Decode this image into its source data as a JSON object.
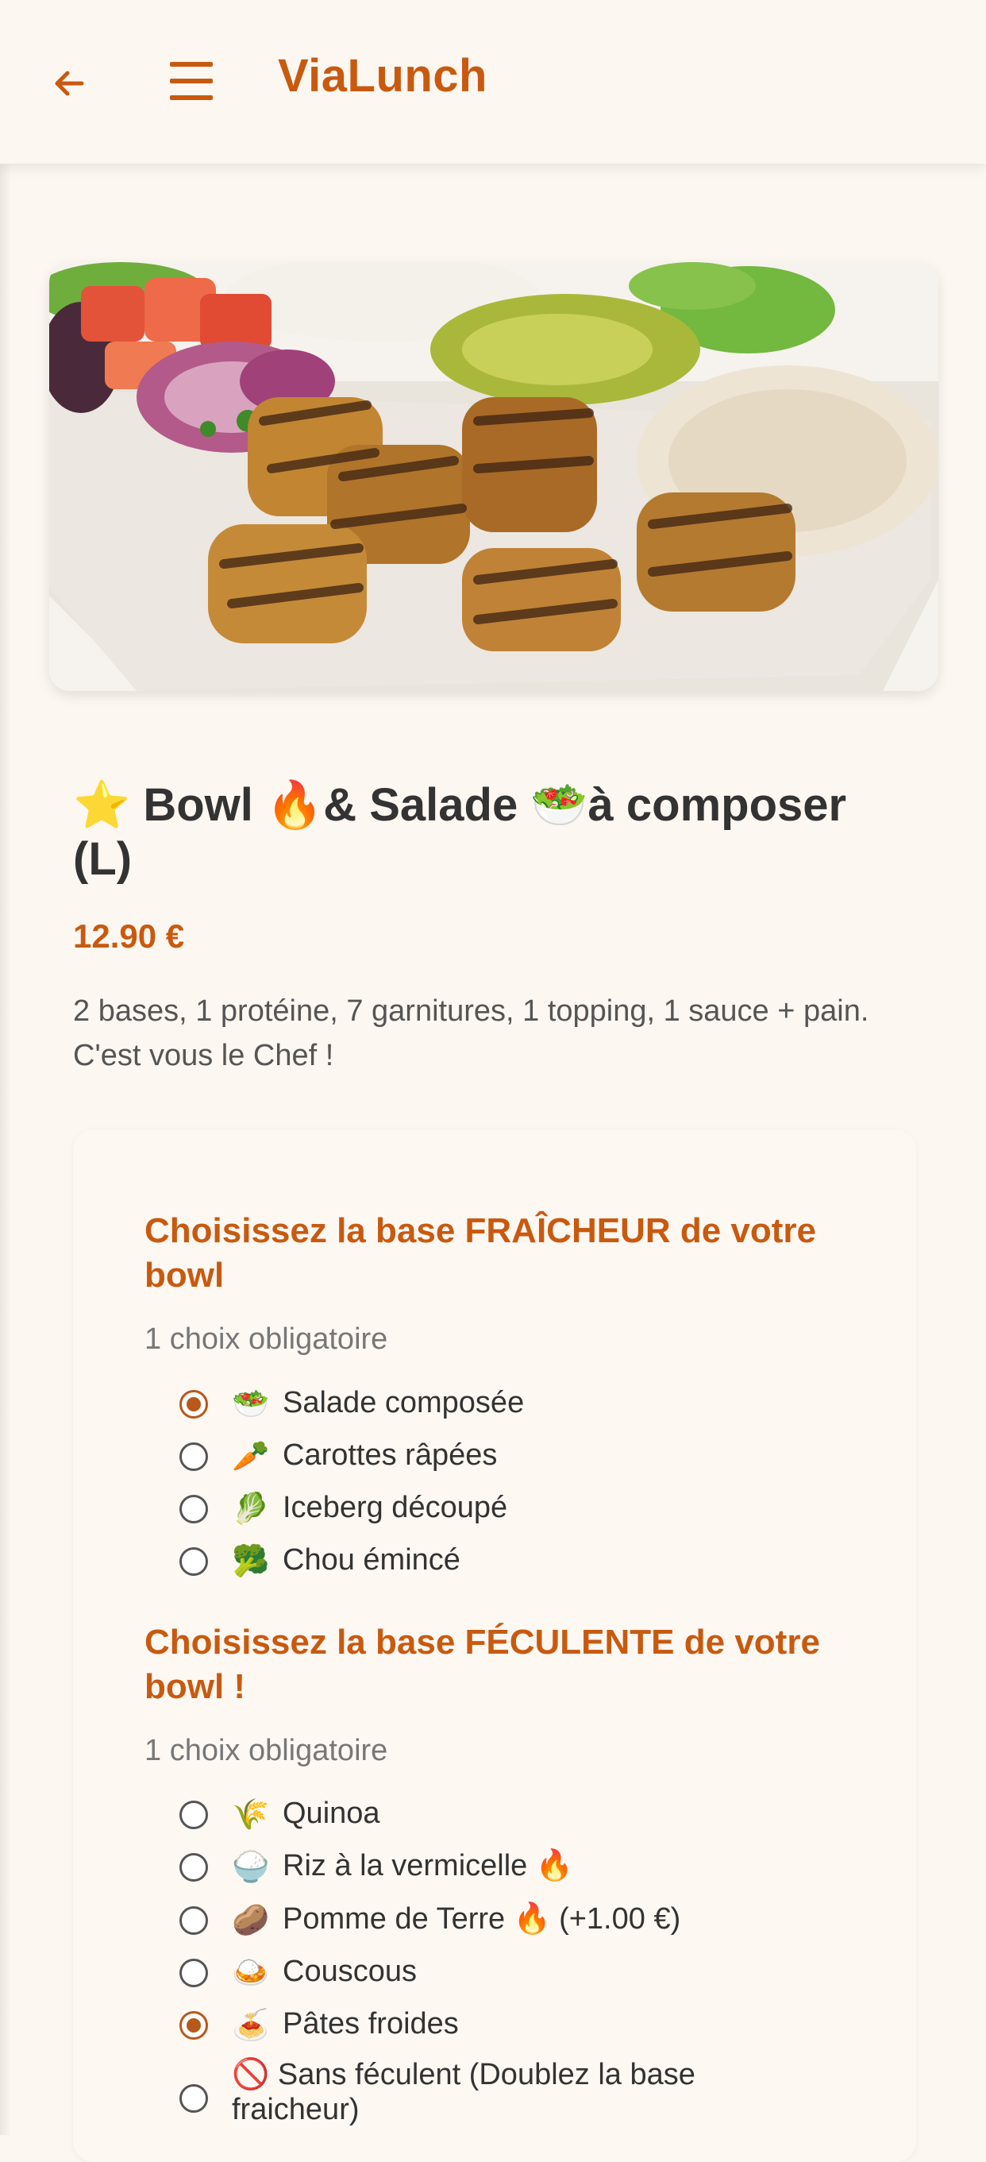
{
  "header": {
    "title": "ViaLunch"
  },
  "product": {
    "title": "⭐ Bowl 🔥& Salade 🥗à composer (L)",
    "price": "12.90 €",
    "description": "2 bases, 1 protéine, 7 garnitures, 1 topping, 1 sauce + pain. C'est vous le Chef !"
  },
  "groups": [
    {
      "title": "Choisissez la base FRAÎCHEUR de votre bowl",
      "subtitle": "1 choix obligatoire",
      "options": [
        {
          "emoji": "🥗",
          "label": "Salade composée",
          "extra": "",
          "checked": true
        },
        {
          "emoji": "🥕",
          "label": "Carottes râpées",
          "extra": "",
          "checked": false
        },
        {
          "emoji": "🥬",
          "label": "Iceberg découpé",
          "extra": "",
          "checked": false
        },
        {
          "emoji": "🥦",
          "label": "Chou émincé",
          "extra": "",
          "checked": false
        }
      ]
    },
    {
      "title": "Choisissez la base FÉCULENTE de votre bowl !",
      "subtitle": "1 choix obligatoire",
      "options": [
        {
          "emoji": "🌾",
          "label": "Quinoa",
          "extra": "",
          "checked": false
        },
        {
          "emoji": "🍚",
          "label": "Riz à la vermicelle 🔥",
          "extra": "",
          "checked": false
        },
        {
          "emoji": "🥔",
          "label": "Pomme de Terre 🔥",
          "extra": "(+1.00 €)",
          "checked": false
        },
        {
          "emoji": "🍛",
          "label": "Couscous",
          "extra": "",
          "checked": false
        },
        {
          "emoji": "🍝",
          "label": "Pâtes froides",
          "extra": "",
          "checked": true
        },
        {
          "emoji": "🚫",
          "label": "Sans féculent (Doublez la base fraicheur)",
          "extra": "",
          "checked": false
        }
      ]
    }
  ],
  "icons": {
    "back": "arrow-left-icon",
    "menu": "hamburger-menu-icon"
  },
  "colors": {
    "accent": "#c85a10",
    "background": "#fdf7f1"
  }
}
